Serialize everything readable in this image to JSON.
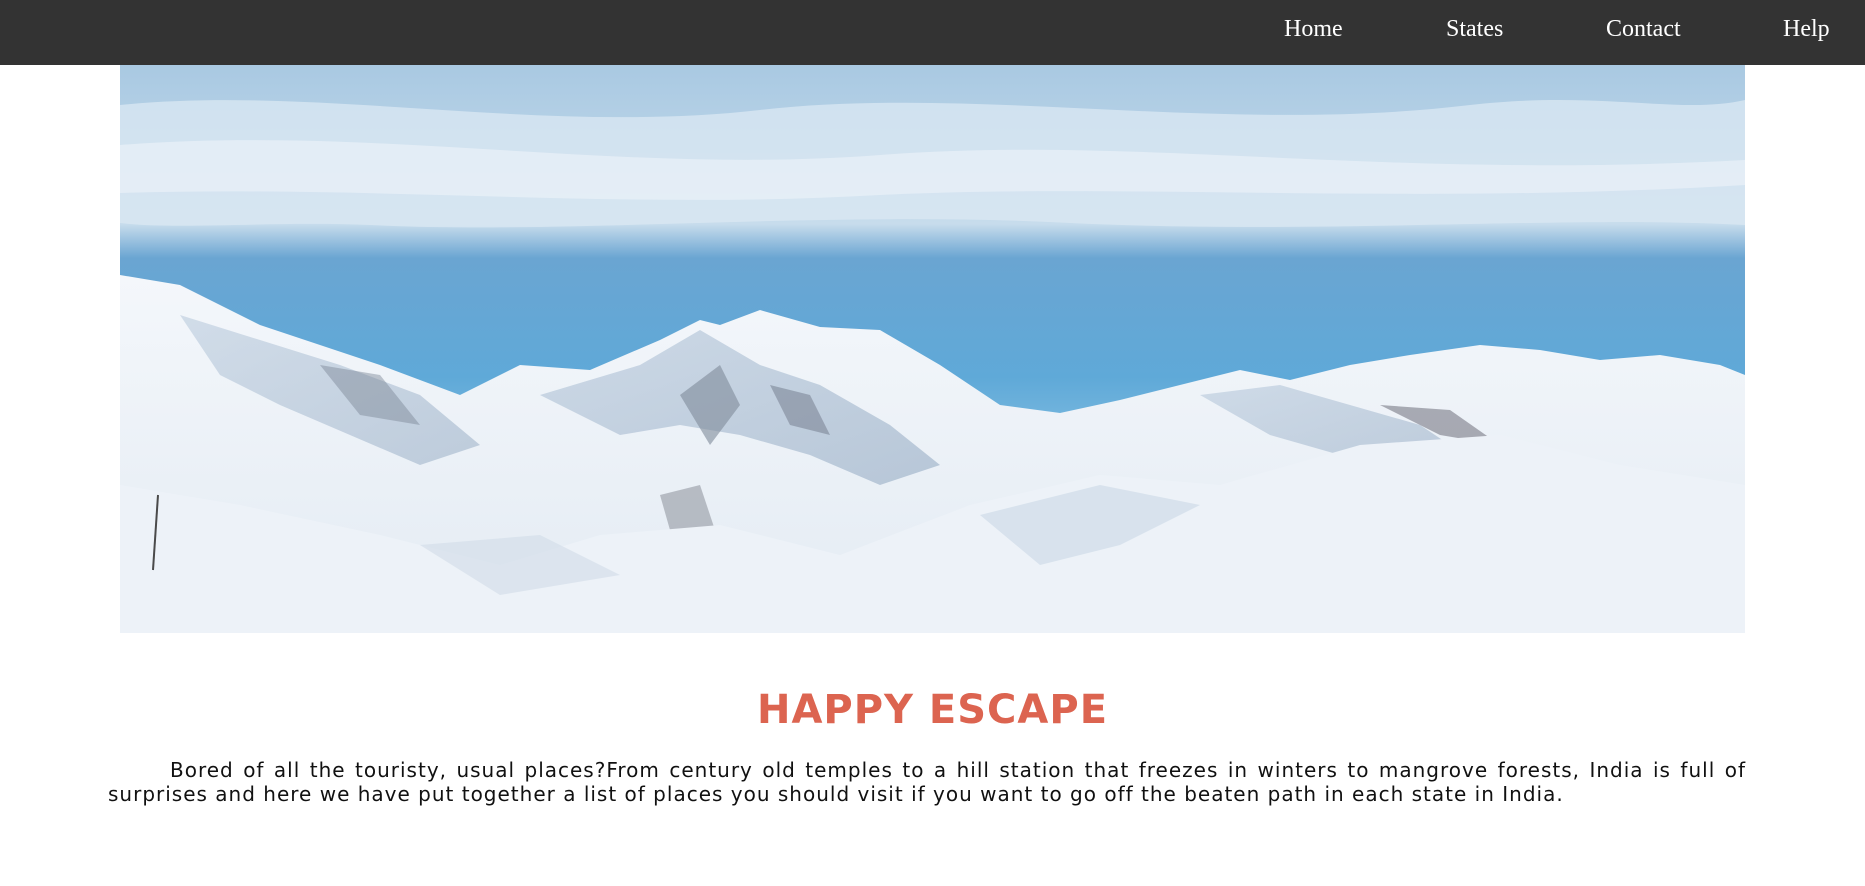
{
  "nav": {
    "items": [
      {
        "label": "Home"
      },
      {
        "label": "States"
      },
      {
        "label": "Contact"
      },
      {
        "label": "Help"
      }
    ],
    "background": "#333333",
    "text_color": "#ffffff"
  },
  "hero": {
    "image": "snowy-mountain-range"
  },
  "main": {
    "title": "HAPPY ESCAPE",
    "title_color": "#dc6450",
    "intro": "Bored of all the touristy, usual places?From century old temples to a hill station that freezes in winters to mangrove forests, India is full of surprises and here we have put together a list of places you should visit if you want to go off the beaten path in each state in India."
  }
}
